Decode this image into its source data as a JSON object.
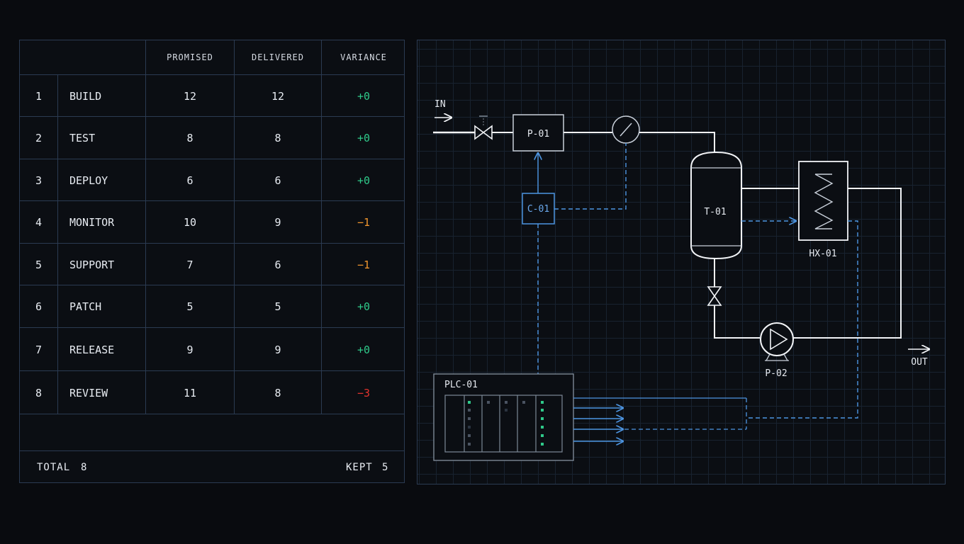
{
  "table": {
    "headers": [
      "PROMISED",
      "DELIVERED",
      "VARIANCE"
    ],
    "rows": [
      {
        "num": "1",
        "name": "BUILD",
        "promised": "12",
        "delivered": "12",
        "variance": "+0",
        "status": "ok"
      },
      {
        "num": "2",
        "name": "TEST",
        "promised": "8",
        "delivered": "8",
        "variance": "+0",
        "status": "ok"
      },
      {
        "num": "3",
        "name": "DEPLOY",
        "promised": "6",
        "delivered": "6",
        "variance": "+0",
        "status": "ok"
      },
      {
        "num": "4",
        "name": "MONITOR",
        "promised": "10",
        "delivered": "9",
        "variance": "−1",
        "status": "warn"
      },
      {
        "num": "5",
        "name": "SUPPORT",
        "promised": "7",
        "delivered": "6",
        "variance": "−1",
        "status": "warn"
      },
      {
        "num": "6",
        "name": "PATCH",
        "promised": "5",
        "delivered": "5",
        "variance": "+0",
        "status": "ok"
      },
      {
        "num": "7",
        "name": "RELEASE",
        "promised": "9",
        "delivered": "9",
        "variance": "+0",
        "status": "ok"
      },
      {
        "num": "8",
        "name": "REVIEW",
        "promised": "11",
        "delivered": "8",
        "variance": "−3",
        "status": "bad"
      }
    ],
    "footer": {
      "total_label": "TOTAL",
      "total_value": "8",
      "kept_label": "KEPT",
      "kept_value": "5"
    }
  },
  "diagram": {
    "labels": {
      "inlet": "IN",
      "outlet": "OUT",
      "pump_p01": "P-01",
      "controller": "C-01",
      "tank": "T-01",
      "heat_exchanger": "HX-01",
      "pump_p02": "P-02",
      "plc": "PLC-01"
    }
  },
  "colors": {
    "process_line": "#f2f4f7",
    "signal_line": "#4d95e2",
    "positive": "#2fc98a",
    "warning": "#f0962e",
    "negative": "#e4332d",
    "grid": "#18222f",
    "border": "#2b3b52"
  }
}
